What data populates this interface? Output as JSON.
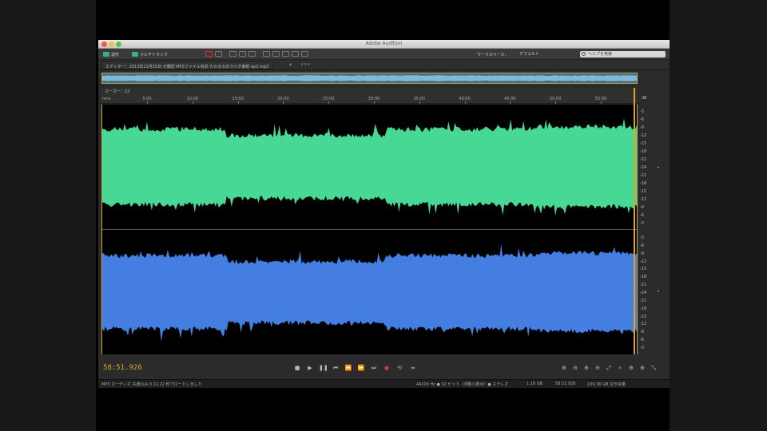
{
  "window": {
    "title": "Adobe Audition"
  },
  "toolbar": {
    "waveform_label": "波形",
    "multitrack_label": "マルチトラック",
    "workspace_label": "ワークスペース：",
    "workspace_value": "デフォルト",
    "search_placeholder": "ヘルプを検索"
  },
  "editor_tab": {
    "label": "エディター：2013年11月15日 ゼ翻訳 MP3ファイル名前 たかまるのラジオ番組 ep2.mp3",
    "close": "×",
    "menu": "▾ ▾ ▾"
  },
  "ruler": {
    "marker_label": "マーカー：12",
    "unit": "hms",
    "ticks": [
      "5:00",
      "10:00",
      "15:00",
      "20:00",
      "25:00",
      "30:00",
      "35:00",
      "40:00",
      "45:00",
      "50:00",
      "55:00"
    ]
  },
  "db_scale": {
    "head": "dB",
    "top_channel": [
      "-3",
      "-6",
      "-9",
      "-12",
      "-15",
      "-18",
      "-21",
      "-24",
      "-21",
      "-18",
      "-15",
      "-12",
      "-9",
      "-6",
      "-3"
    ],
    "bottom_channel": [
      "-3",
      "-6",
      "-9",
      "-12",
      "-15",
      "-18",
      "-21",
      "-24",
      "-21",
      "-18",
      "-15",
      "-12",
      "-9",
      "-6",
      "-3"
    ]
  },
  "colors": {
    "top_channel": "#46d894",
    "bottom_channel": "#437ee0",
    "accent": "#d9a922",
    "record": "#dd3333"
  },
  "transport": {
    "timecode": "58:51.926",
    "buttons": [
      {
        "name": "stop-button",
        "icon": "■"
      },
      {
        "name": "play-button",
        "icon": "▶"
      },
      {
        "name": "pause-button",
        "icon": "❚❚"
      },
      {
        "name": "go-to-start-button",
        "icon": "⏮"
      },
      {
        "name": "rewind-button",
        "icon": "⏪"
      },
      {
        "name": "fast-forward-button",
        "icon": "⏩"
      },
      {
        "name": "go-to-end-button",
        "icon": "⏭"
      },
      {
        "name": "record-button",
        "icon": "●"
      },
      {
        "name": "loop-button",
        "icon": "⟲"
      },
      {
        "name": "skip-button",
        "icon": "⇥"
      }
    ],
    "zoom_buttons": [
      {
        "name": "zoom-in-amplitude-button",
        "icon": "⊕"
      },
      {
        "name": "zoom-out-amplitude-button",
        "icon": "⊖"
      },
      {
        "name": "zoom-in-time-button",
        "icon": "⊕"
      },
      {
        "name": "zoom-out-time-button",
        "icon": "⊖"
      },
      {
        "name": "zoom-full-button",
        "icon": "⤢"
      },
      {
        "name": "zoom-selection-button",
        "icon": "⌕"
      },
      {
        "name": "zoom-in-left-button",
        "icon": "⊕"
      },
      {
        "name": "zoom-in-right-button",
        "icon": "⊕"
      },
      {
        "name": "zoom-reset-button",
        "icon": "⤡"
      }
    ]
  },
  "status": {
    "left": "MP3 オーディオ 共通のみ 0.11.22 秒でロードしました",
    "sample_rate": "44100 Hz ● 32 ビット（浮動小数点）● ステレオ",
    "file_size": "1.16 GB",
    "duration": "58:51.926",
    "free_space": "109.36 GB 空き容量"
  }
}
